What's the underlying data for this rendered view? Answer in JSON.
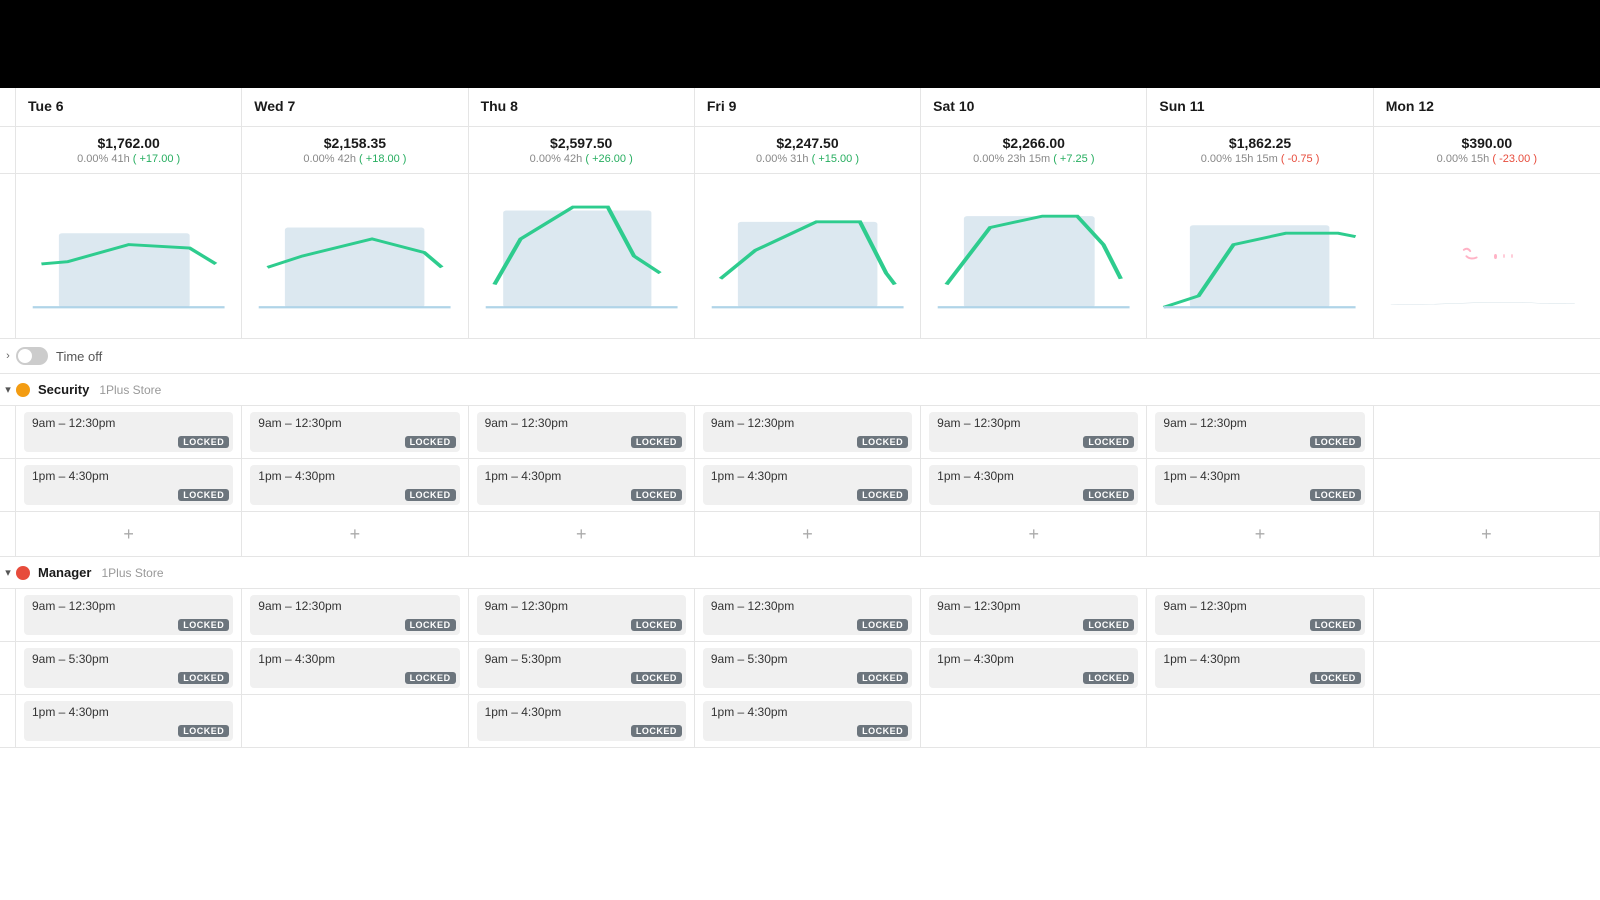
{
  "topBar": {
    "height": 88
  },
  "days": [
    {
      "label": "Tue 6",
      "amount": "$1,762.00",
      "detail": "0.00%  41h",
      "change": "+17.00",
      "changePositive": true
    },
    {
      "label": "Wed 7",
      "amount": "$2,158.35",
      "detail": "0.00%  42h",
      "change": "+18.00",
      "changePositive": true
    },
    {
      "label": "Thu 8",
      "amount": "$2,597.50",
      "detail": "0.00%  42h",
      "change": "+26.00",
      "changePositive": true
    },
    {
      "label": "Fri 9",
      "amount": "$2,247.50",
      "detail": "0.00%  31h",
      "change": "+15.00",
      "changePositive": true
    },
    {
      "label": "Sat 10",
      "amount": "$2,266.00",
      "detail": "0.00%  23h 15m",
      "change": "+7.25",
      "changePositive": true
    },
    {
      "label": "Sun 11",
      "amount": "$1,862.25",
      "detail": "0.00%  15h 15m",
      "change": "-0.75",
      "changePositive": false
    },
    {
      "label": "Mon 12",
      "amount": "$390.00",
      "detail": "0.00%  15h",
      "change": "-23.00",
      "changePositive": false
    }
  ],
  "timeoff": {
    "label": "Time off"
  },
  "roles": [
    {
      "name": "Security",
      "store": "1Plus Store",
      "color": "security",
      "scheduleRows": [
        {
          "shifts": [
            "9am – 12:30pm",
            "9am – 12:30pm",
            "9am – 12:30pm",
            "9am – 12:30pm",
            "9am – 12:30pm",
            "9am – 12:30pm",
            ""
          ]
        },
        {
          "shifts": [
            "1pm – 4:30pm",
            "1pm – 4:30pm",
            "1pm – 4:30pm",
            "1pm – 4:30pm",
            "1pm – 4:30pm",
            "1pm – 4:30pm",
            ""
          ]
        }
      ]
    },
    {
      "name": "Manager",
      "store": "1Plus Store",
      "color": "manager",
      "scheduleRows": [
        {
          "shifts": [
            "9am – 12:30pm",
            "9am – 12:30pm",
            "9am – 12:30pm",
            "9am – 12:30pm",
            "9am – 12:30pm",
            "9am – 12:30pm",
            ""
          ]
        },
        {
          "shifts": [
            "9am – 5:30pm",
            "1pm – 4:30pm",
            "9am – 5:30pm",
            "9am – 5:30pm",
            "1pm – 4:30pm",
            "1pm – 4:30pm",
            ""
          ]
        },
        {
          "shifts": [
            "1pm – 4:30pm",
            "",
            "1pm – 4:30pm",
            "1pm – 4:30pm",
            "",
            "",
            ""
          ]
        }
      ]
    }
  ],
  "addLabel": "+",
  "lockedLabel": "LOCKED",
  "chevronDown": "▾",
  "chevronRight": "›"
}
